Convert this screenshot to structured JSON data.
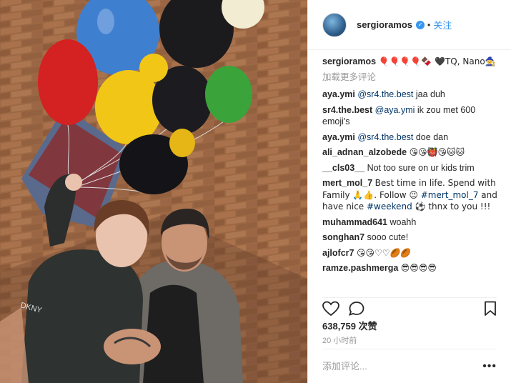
{
  "header": {
    "username": "sergioramos",
    "verified_symbol": "✓",
    "dot": "•",
    "follow_label": "关注"
  },
  "caption": {
    "username": "sergioramos",
    "text": "🎈🎈🎈🎈🍫 🖤TQ, Nano🧙"
  },
  "load_more": "加载更多评论",
  "comments": [
    {
      "user": "aya.ymi",
      "mention": "@sr4.the.best",
      "text": "jaa duh"
    },
    {
      "user": "sr4.the.best",
      "mention": "@aya.ymi",
      "text": "ik zou met 600 emoji's"
    },
    {
      "user": "aya.ymi",
      "mention": "@sr4.the.best",
      "text": "doe dan"
    },
    {
      "user": "ali_adnan_alzobede",
      "mention": "",
      "text": "😘😘👹😘🐱🐱"
    },
    {
      "user": "__cls03__",
      "mention": "",
      "text": "Not too sure on ur kids trim"
    },
    {
      "user": "mert_mol_7",
      "mention": "",
      "text": "Best time in life. Spend with Family 🙏👍. Follow 😉 #mert_mol_7 and have nice #weekend ⚽ thnx to you !!!"
    },
    {
      "user": "muhammad641",
      "mention": "",
      "text": "woahh"
    },
    {
      "user": "songhan7",
      "mention": "",
      "text": "sooo cute!"
    },
    {
      "user": "ajlofcr7",
      "mention": "",
      "text": "😘😘♡♡🏉🏉"
    },
    {
      "user": "ramze.pashmerga",
      "mention": "",
      "text": "😎😎😎😎"
    }
  ],
  "actions": {
    "like_icon": "heart-icon",
    "comment_icon": "comment-icon",
    "save_icon": "bookmark-icon"
  },
  "likes": "638,759 次赞",
  "time": "20 小时前",
  "add_comment_placeholder": "添加评论...",
  "more_options": "•••",
  "photo": {
    "alt": "Man and child holding colorful balloons in front of a brick wall",
    "shirt_text": "DKNY"
  }
}
